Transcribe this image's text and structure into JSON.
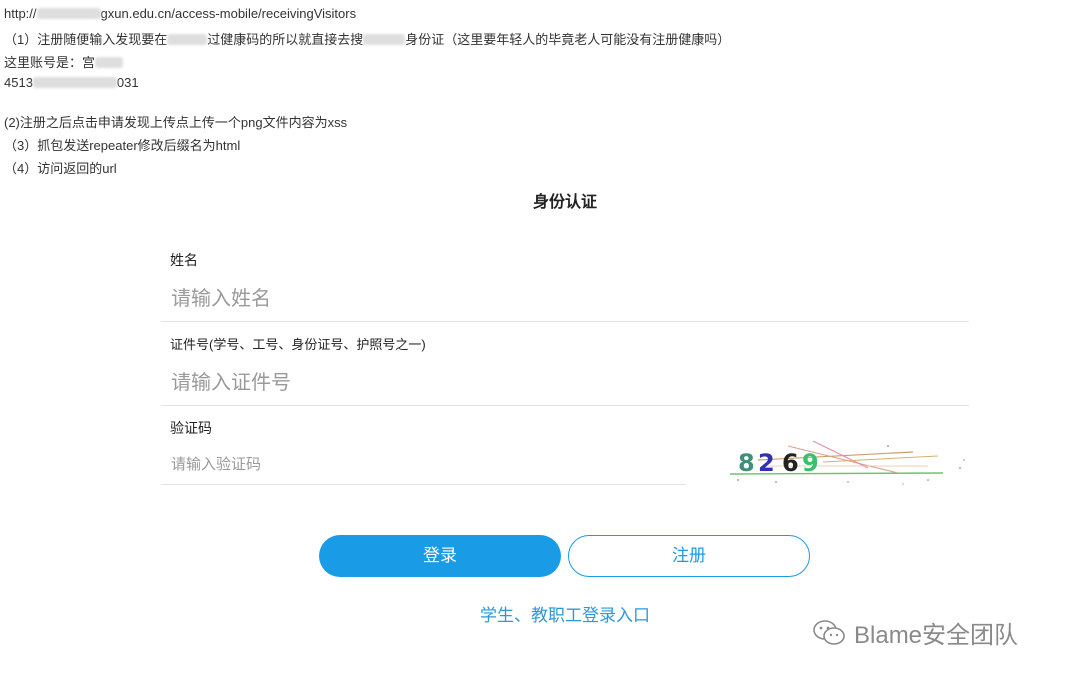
{
  "notes": {
    "url_prefix": "http://",
    "url_mid": "gxun.edu.cn/access-mobile/receivingVisitors",
    "step1_a": "（1）注册随便输入发现要在",
    "step1_b": "过健康码的所以就直接去搜",
    "step1_c": "身份证（这里要年轻人的毕竟老人可能没有注册健康吗）",
    "account_label": "这里账号是：",
    "account_name_partial": "宫",
    "id_prefix": "4513",
    "id_suffix": "031",
    "step2": "(2)注册之后点击申请发现上传点上传一个png文件内容为xss",
    "step3": "（3）抓包发送repeater修改后缀名为html",
    "step4": "（4）访问返回的url"
  },
  "form": {
    "title": "身份认证",
    "name": {
      "label": "姓名",
      "placeholder": "请输入姓名"
    },
    "id": {
      "label": "证件号(学号、工号、身份证号、护照号之一)",
      "placeholder": "请输入证件号"
    },
    "captcha": {
      "label": "验证码",
      "placeholder": "请输入验证码",
      "digits": [
        "8",
        "2",
        "6",
        "9"
      ]
    }
  },
  "buttons": {
    "login": "登录",
    "register": "注册"
  },
  "entry_link": "学生、教职工登录入口",
  "watermark": "Blame安全团队",
  "colors": {
    "primary": "#1a9be6",
    "link": "#2b9ad8"
  }
}
